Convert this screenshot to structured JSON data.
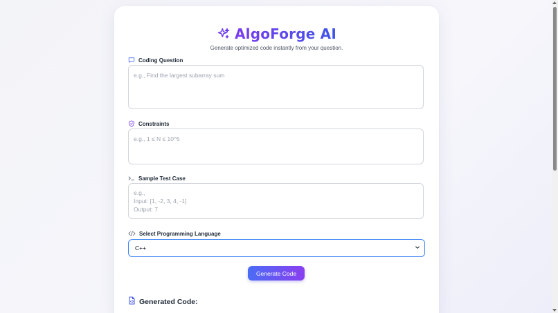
{
  "header": {
    "title": "AlgoForge AI",
    "subtitle": "Generate optimized code instantly from your question.",
    "icon": "sparkles-icon"
  },
  "fields": {
    "question": {
      "label": "Coding Question",
      "icon": "chat-icon",
      "placeholder": "e.g., Find the largest subarray sum",
      "value": ""
    },
    "constraints": {
      "label": "Constraints",
      "icon": "shield-icon",
      "placeholder": "e.g., 1 ≤ N ≤ 10^5",
      "value": ""
    },
    "testcase": {
      "label": "Sample Test Case",
      "icon": "terminal-icon",
      "placeholder": "e.g.,\nInput: [1, -2, 3, 4, -1]\nOutput: 7",
      "value": ""
    },
    "language": {
      "label": "Select Programming Language",
      "icon": "code-icon",
      "selected": "C++"
    }
  },
  "actions": {
    "generate_label": "Generate Code"
  },
  "output": {
    "heading": "Generated Code:",
    "icon": "document-code-icon"
  },
  "colors": {
    "accent_start": "#7a3cf0",
    "accent_end": "#3f55e6",
    "focus_border": "#3b82f6"
  }
}
